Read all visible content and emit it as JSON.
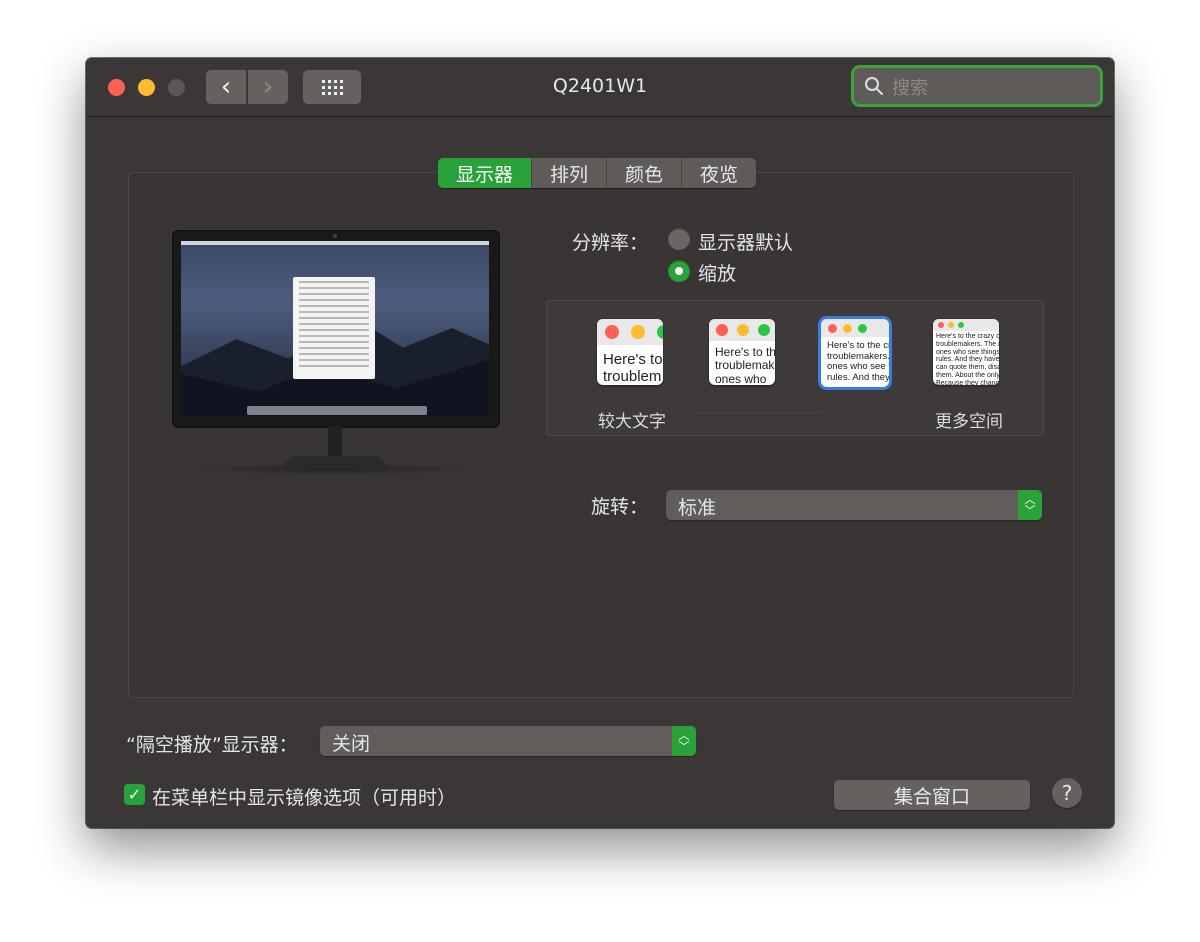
{
  "window": {
    "title": "Q2401W1"
  },
  "toolbar": {
    "back_glyph": "‹",
    "forward_glyph": "›",
    "show_all_icon": "grid-icon"
  },
  "search": {
    "placeholder": "搜索",
    "icon": "search-icon"
  },
  "tabs": [
    {
      "label": "显示器",
      "active": true
    },
    {
      "label": "排列",
      "active": false
    },
    {
      "label": "颜色",
      "active": false
    },
    {
      "label": "夜览",
      "active": false
    }
  ],
  "resolution": {
    "label": "分辨率：",
    "options": [
      {
        "label": "显示器默认",
        "selected": false
      },
      {
        "label": "缩放",
        "selected": true
      }
    ],
    "scale": {
      "left_caption": "较大文字",
      "right_caption": "更多空间",
      "selected_index": 2,
      "thumbs": [
        {
          "text": "Here's to\ntroublem"
        },
        {
          "text": "Here's to th\ntroublemak\nones who"
        },
        {
          "text": "Here's to the cr\ntroublemakers.\nones who see t\nrules. And they"
        },
        {
          "text": "Here's to the crazy one\ntroublemakers. The rou\nones who see things di\nrules. And they have no\ncan quote them, disagr\nthem. About the only th\nBecause they change t"
        }
      ]
    }
  },
  "rotation": {
    "label": "旋转：",
    "value": "标准"
  },
  "airplay": {
    "label": "“隔空播放”显示器：",
    "value": "关闭"
  },
  "mirror_option": {
    "label": "在菜单栏中显示镜像选项（可用时）",
    "checked": true
  },
  "gather_button": {
    "label": "集合窗口"
  },
  "help_button": {
    "label": "?"
  },
  "colors": {
    "accent": "#2aa23a",
    "selection": "#3b7be3"
  }
}
